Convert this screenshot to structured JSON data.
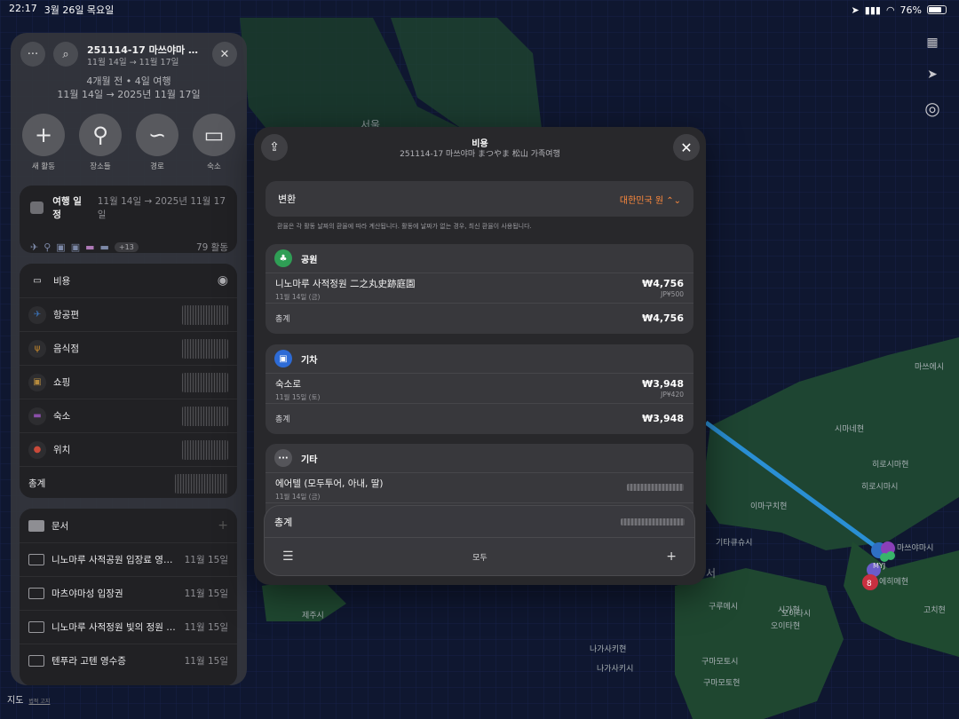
{
  "status": {
    "time": "22:17",
    "date": "3월 26일 목요일",
    "battery": "76%",
    "battery_level": 0.76
  },
  "sidebar": {
    "trip_title": "251114-17 마쓰야마 まつやま 松山 가족여행",
    "trip_dates_short": "11월 14일 → 11월 17일",
    "trip_meta": "4개월 전 • 4일 여행",
    "trip_range": "11월 14일 → 2025년 11월 17일",
    "actions": [
      {
        "label": "새 활동",
        "icon": "plus-icon"
      },
      {
        "label": "장소들",
        "icon": "pin-icon"
      },
      {
        "label": "경로",
        "icon": "route-icon"
      },
      {
        "label": "숙소",
        "icon": "bed-icon"
      }
    ],
    "schedule": {
      "title": "여행 일정",
      "range": "11월 14일 → 2025년 11월 17일",
      "more": "+13",
      "count": "79 활동"
    },
    "costs": {
      "title": "비용",
      "items": [
        {
          "label": "항공편",
          "icon": "airplane-icon",
          "color": "#3a6fb0"
        },
        {
          "label": "음식점",
          "icon": "fork-knife-icon",
          "color": "#c98a2c"
        },
        {
          "label": "쇼핑",
          "icon": "bag-icon",
          "color": "#b58a3e"
        },
        {
          "label": "숙소",
          "icon": "bed-icon",
          "color": "#8a4fa8"
        },
        {
          "label": "위치",
          "icon": "pin-icon",
          "color": "#c94a3a"
        }
      ],
      "total_label": "총계"
    },
    "documents": {
      "title": "문서",
      "items": [
        {
          "name": "니노마루 사적공원 입장료 영수증",
          "date": "11월 15일"
        },
        {
          "name": "마츠야마성 입장권",
          "date": "11월 15일"
        },
        {
          "name": "니노마루 사적정원 빛의 정원 입장권",
          "date": "11월 15일"
        },
        {
          "name": "텐푸라 고텐 영수증",
          "date": "11월 15일"
        }
      ]
    }
  },
  "map": {
    "labels": [
      {
        "text": "서울",
        "cls": "big"
      },
      {
        "text": "마쓰에시"
      },
      {
        "text": "시마네현"
      },
      {
        "text": "히로시마현"
      },
      {
        "text": "히로시마시"
      },
      {
        "text": "이마구치현"
      },
      {
        "text": "기타큐슈시"
      },
      {
        "text": "에히메현"
      },
      {
        "text": "마쓰야마시"
      },
      {
        "text": "MYJ"
      },
      {
        "text": "시가현"
      },
      {
        "text": "구루메시"
      },
      {
        "text": "오이타시"
      },
      {
        "text": "오이타현"
      },
      {
        "text": "고치현"
      },
      {
        "text": "구마모토시"
      },
      {
        "text": "구마모토현"
      },
      {
        "text": "나가사키현"
      },
      {
        "text": "나가사키시"
      },
      {
        "text": "제주시"
      },
      {
        "text": "서"
      }
    ],
    "attribution": "지도",
    "legal": "법적 고지"
  },
  "modal": {
    "title": "비용",
    "subtitle": "251114-17 마쓰야마 まつやま 松山 가족여행",
    "conversion": {
      "label": "변환",
      "value": "대한민국 원 ⌃⌄"
    },
    "note": "환율은 각 활동 날짜의 환율에 따라 계산됩니다. 활동에 날짜가 없는 경우, 최신 환율이 사용됩니다.",
    "sections": [
      {
        "title": "공원",
        "icon": "park-icon",
        "color": "#2f9e55",
        "item": {
          "name": "니노마루 사적정원 二之丸史跡庭園",
          "date": "11월 14일 (금)",
          "amount": "₩4,756",
          "orig": "JP¥500"
        },
        "total_label": "총계",
        "total": "₩4,756"
      },
      {
        "title": "기차",
        "icon": "train-icon",
        "color": "#2d6bd6",
        "item": {
          "name": "숙소로",
          "date": "11월 15일 (토)",
          "amount": "₩3,948",
          "orig": "JP¥420"
        },
        "total_label": "총계",
        "total": "₩3,948"
      },
      {
        "title": "기타",
        "icon": "ellipsis-icon",
        "color": "#55555a",
        "item": {
          "name": "에어텔 (모두투어, 아내, 딸)",
          "date": "11월 14일 (금)"
        }
      }
    ],
    "bottom": {
      "total_label": "총계",
      "filter_label": "모두"
    }
  },
  "colors": {
    "accent": "#ff8a3d",
    "route": "#2a8fd4"
  }
}
